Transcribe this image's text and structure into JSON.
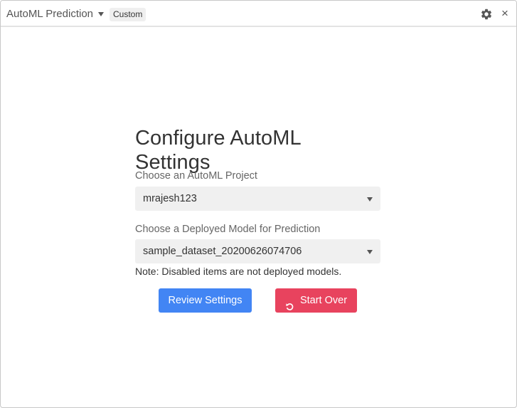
{
  "titlebar": {
    "app_title": "AutoML Prediction",
    "badge": "Custom",
    "icons": [
      "chevron-down-icon",
      "gear-icon",
      "close-icon"
    ],
    "close_glyph": "×"
  },
  "form": {
    "heading": "Configure AutoML Settings",
    "project_label": "Choose an AutoML Project",
    "project_value": "mrajesh123",
    "model_label": "Choose a Deployed Model for Prediction",
    "model_value": "sample_dataset_20200626074706",
    "note": "Note: Disabled items are not deployed models."
  },
  "buttons": {
    "review_label": "Review Settings",
    "start_over_label": "Start Over",
    "start_over_icon": "undo-icon"
  },
  "colors": {
    "primary": "#4285f4",
    "danger": "#e8435e",
    "select_bg": "#f0f0f0"
  }
}
